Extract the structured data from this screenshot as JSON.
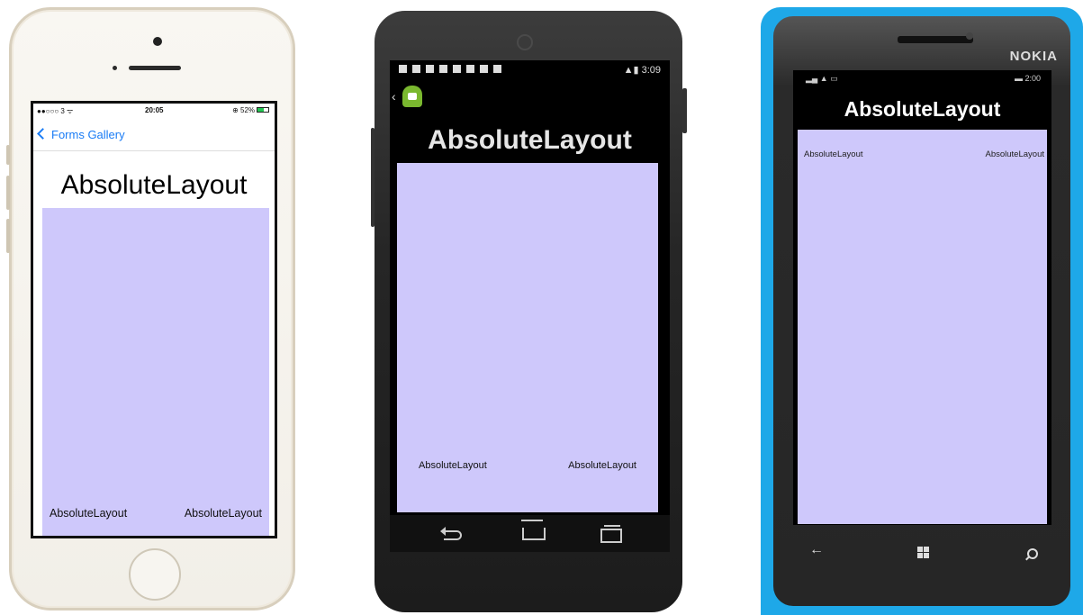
{
  "colors": {
    "layout_background": "#cec8fb",
    "ios_accent": "#1a7cf5",
    "nokia_frame": "#1ea8e8"
  },
  "ios": {
    "status": {
      "carrier": "●●○○○ 3 ᯤ",
      "time": "20:05",
      "battery": "⊕ 52%"
    },
    "nav": {
      "back_label": "Forms Gallery"
    },
    "title": "AbsoluteLayout",
    "labels": [
      "AbsoluteLayout",
      "AbsoluteLayout"
    ]
  },
  "android": {
    "status": {
      "time": "3:09",
      "signal": "▲▮"
    },
    "title": "AbsoluteLayout",
    "labels": [
      "AbsoluteLayout",
      "AbsoluteLayout"
    ]
  },
  "nokia": {
    "brand": "NOKIA",
    "status": {
      "left": "▂▄ ▲ ▭",
      "right": "▬ 2:00"
    },
    "title": "AbsoluteLayout",
    "labels": [
      "AbsoluteLayout",
      "AbsoluteLayout"
    ]
  }
}
